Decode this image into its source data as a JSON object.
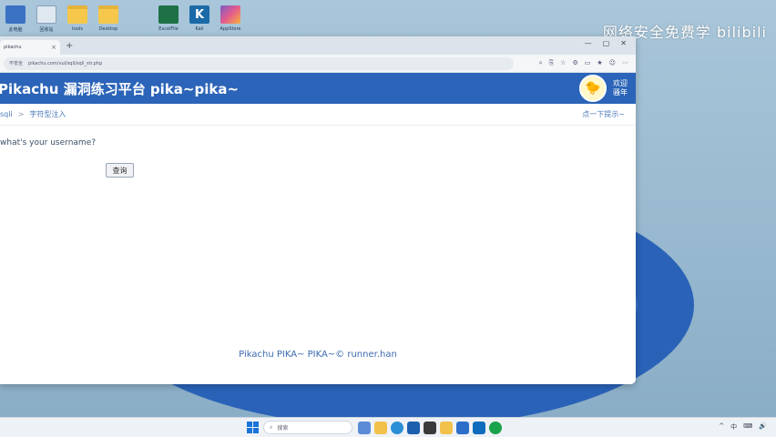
{
  "desktop": {
    "icons": [
      {
        "label": "此电脑",
        "icon": "computer-icon"
      },
      {
        "label": "回收站",
        "icon": "recycle-bin-icon"
      },
      {
        "label": "tools",
        "icon": "folder-icon"
      },
      {
        "label": "Desktop",
        "icon": "folder-icon"
      },
      {
        "label": "ExcelFile",
        "icon": "excel-icon"
      },
      {
        "label": "Kali",
        "icon": "k-app-icon"
      },
      {
        "label": "AppStore",
        "icon": "app-icon"
      }
    ],
    "watermark": "网络安全免费学 bilibili"
  },
  "browser": {
    "tab_title": "pikachu",
    "tab_close": "×",
    "new_tab": "+",
    "window_controls": [
      "—",
      "▢",
      "✕"
    ],
    "security_label": "不安全",
    "url": "pikachu.com/vul/sqli/sqli_str.php",
    "toolbar_icons": [
      "zoom-icon",
      "share-icon",
      "star-icon",
      "extensions-icon",
      "split-icon",
      "favorites-icon",
      "profile-icon",
      "more-icon"
    ]
  },
  "site": {
    "title": "Pikachu 漏洞练习平台 pika~pika~",
    "avatar_glyph": "🐤",
    "welcome_line1": "欢迎",
    "welcome_line2": "骚年",
    "breadcrumb": {
      "parent": "sqli",
      "separator": ">",
      "current": "字符型注入"
    },
    "hint": "点一下提示~",
    "question": "what's your username?",
    "query_button": "查询",
    "footer": "Pikachu PIKA~ PIKA~© runner.han"
  },
  "taskbar": {
    "search_placeholder": "搜索",
    "tray_items": [
      "^",
      "中",
      "⌨",
      "🔊"
    ]
  }
}
